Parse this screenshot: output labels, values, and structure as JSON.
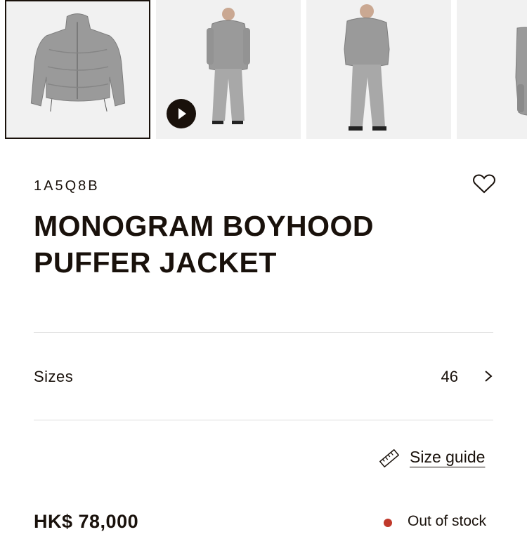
{
  "gallery": {
    "images": [
      {
        "alt": "jacket-front",
        "selected": true
      },
      {
        "alt": "model-front-video",
        "selected": false
      },
      {
        "alt": "model-front",
        "selected": false
      },
      {
        "alt": "model-side",
        "selected": false
      }
    ],
    "video_icon": "play-icon"
  },
  "product": {
    "sku": "1A5Q8B",
    "title": "MONOGRAM BOYHOOD PUFFER JACKET",
    "wishlist_icon": "heart-icon"
  },
  "sizes": {
    "label": "Sizes",
    "selected": "46",
    "icon": "chevron-right-icon"
  },
  "size_guide": {
    "label": "Size guide",
    "icon": "ruler-icon"
  },
  "purchase": {
    "price": "HK$ 78,000",
    "stock_status": "Out of stock",
    "stock_color": "#c0392b"
  },
  "colors": {
    "text": "#19110b",
    "divider": "#dcdcdc",
    "image_bg": "#f1f1f1",
    "jacket": "#9a9a9a"
  }
}
